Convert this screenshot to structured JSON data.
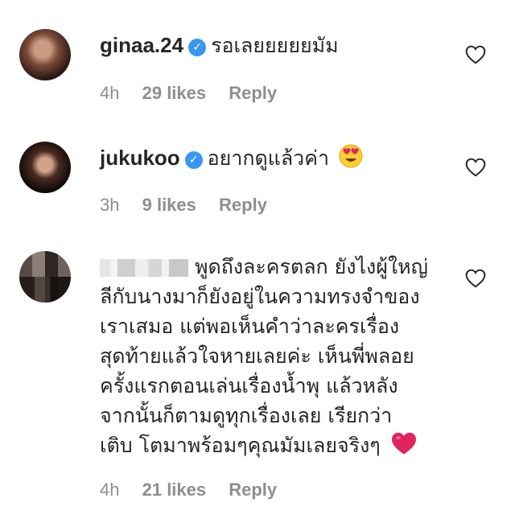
{
  "comments": [
    {
      "username": "ginaa.24",
      "verified": true,
      "text": "รอเลยยยยยมัม",
      "time": "4h",
      "likes": "29 likes",
      "reply": "Reply"
    },
    {
      "username": "jukukoo",
      "verified": true,
      "text": "อยากดูแล้วค่า",
      "emoji": "heart-eyes-emoji",
      "time": "3h",
      "likes": "9 likes",
      "reply": "Reply"
    },
    {
      "username_hidden": true,
      "lines": [
        "พูดถึงละครตลก ยังไงผู้ใหญ่",
        "ลีกับนางมาก็ยังอยู่ในความทรงจำของ",
        "เราเสมอ แต่พอเห็นคำว่าละครเรื่อง",
        "สุดท้ายแล้วใจหายเลยค่ะ เห็นพี่พลอย",
        "ครั้งแรกตอนเล่นเรื่องน้ำพุ แล้วหลัง",
        "จากนั้นก็ตามดูทุกเรื่องเลย เรียกว่า",
        "เติบ โตมาพร้อมๆคุณมัมเลยจริงๆ"
      ],
      "emoji": "red-heart-emoji",
      "time": "4h",
      "likes": "21 likes",
      "reply": "Reply"
    }
  ],
  "colors": {
    "text": "#262626",
    "meta": "#8e8e8e",
    "verified": "#3897f0",
    "heart_red": "#e0245e"
  }
}
